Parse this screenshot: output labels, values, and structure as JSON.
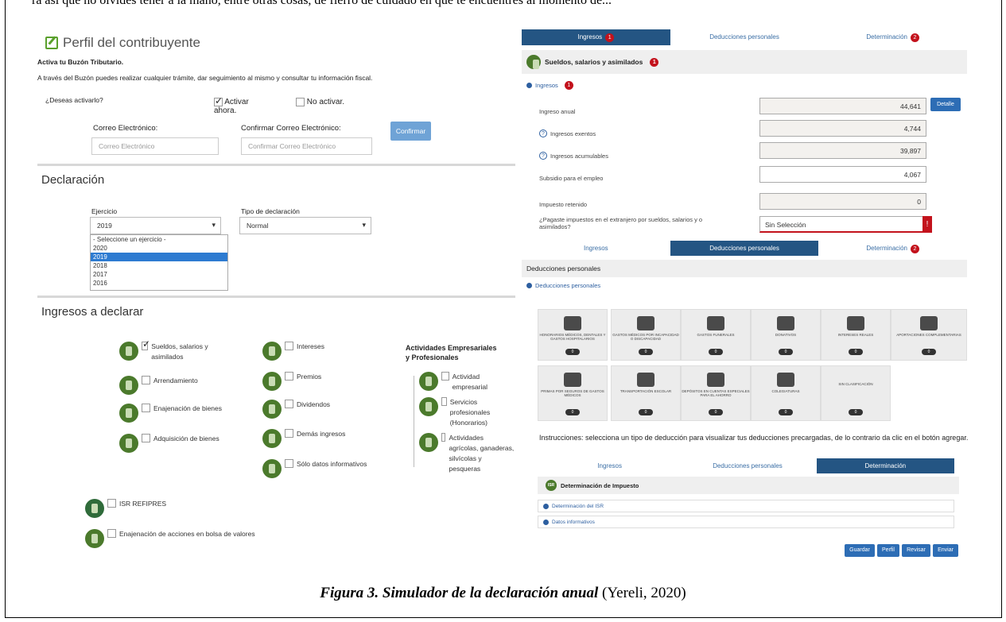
{
  "top_text": "ra así que no olvides tener a la mano, entre otras cosas, de fierro de cuidado en que te encuentres al momento de...",
  "perfil": {
    "title": "Perfil del contribuyente",
    "subtitle": "Activa tu Buzón Tributario.",
    "desc": "A través del Buzón puedes realizar cualquier trámite, dar seguimiento al mismo y consultar tu información fiscal.",
    "question": "¿Deseas activarlo?",
    "opt_yes": "Activar ahora.",
    "opt_no": "No activar.",
    "email_label": "Correo Electrónico:",
    "email_placeholder": "Correo Electrónico",
    "confirm_label": "Confirmar Correo Electrónico:",
    "confirm_placeholder": "Confirmar Correo Electrónico",
    "confirm_button": "Confirmar"
  },
  "declaracion": {
    "title": "Declaración",
    "ejercicio_label": "Ejercicio",
    "ejercicio_value": "2019",
    "tipo_label": "Tipo de declaración",
    "tipo_value": "Normal",
    "options": [
      "- Seleccione un ejercicio -",
      "2020",
      "2019",
      "2018",
      "2017",
      "2016"
    ]
  },
  "ingresos": {
    "title": "Ingresos a declarar",
    "col1": [
      "Sueldos, salarios y asimilados",
      "Arrendamiento",
      "Enajenación de bienes",
      "Adquisición de bienes"
    ],
    "col2": [
      "Intereses",
      "Premios",
      "Dividendos",
      "Demás ingresos",
      "Sólo datos informativos"
    ],
    "col3_title": "Actividades Empresariales y Profesionales",
    "col3": [
      "Actividad empresarial",
      "Servicios profesionales (Honorarios)",
      "Actividades agrícolas, ganaderas, silvícolas y pesqueras"
    ],
    "isr_refipres": "ISR REFIPRES",
    "isr_badge": "ISR",
    "enajenacion_acciones": "Enajenación de acciones en bolsa de valores"
  },
  "tabs1": {
    "ingresos": "Ingresos",
    "ingresos_badge": "1",
    "deducciones": "Deducciones personales",
    "determinacion": "Determinación",
    "determinacion_badge": "2"
  },
  "sueldos": {
    "header": "Sueldos, salarios y asimilados",
    "header_badge": "1",
    "sub": "Ingresos",
    "sub_badge": "1",
    "rows": [
      {
        "label": "Ingreso anual",
        "value": "44,641"
      },
      {
        "label": "Ingresos exentos",
        "value": "4,744"
      },
      {
        "label": "Ingresos acumulables",
        "value": "39,897"
      },
      {
        "label": "Subsidio para el empleo",
        "value": "4,067"
      },
      {
        "label": "Impuesto retenido",
        "value": "0"
      }
    ],
    "detalle": "Detalle",
    "extranjero_label": "¿Pagaste impuestos en el extranjero por sueldos, salarios y o asimilados?",
    "extranjero_value": "Sin Selección"
  },
  "deducciones": {
    "header": "Deducciones personales",
    "sub": "Deducciones personales",
    "row1": [
      "HONORARIOS MÉDICOS, DENTALES Y GASTOS HOSPITALARIOS",
      "GASTOS MÉDICOS POR INCAPACIDAD O DISCAPACIDAD",
      "GASTOS FUNERALES",
      "DONATIVOS",
      "INTERESES REALES",
      "APORTACIONES COMPLEMENTARIAS"
    ],
    "row2": [
      "PRIMAS POR SEGUROS DE GASTOS MÉDICOS",
      "TRANSPORTACIÓN ESCOLAR",
      "DEPÓSITOS EN CUENTAS ESPECIALES PARA EL AHORRO",
      "COLEGIATURAS",
      "SIN CLASIFICACIÓN"
    ],
    "count": "0",
    "instructions": "Instrucciones: selecciona un tipo de deducción para visualizar tus deducciones precargadas, de lo contrario da clic en el botón agregar."
  },
  "determinacion": {
    "header": "Determinación de Impuesto",
    "isr_badge": "ISR",
    "items": [
      "Determinación del ISR",
      "Datos informativos"
    ],
    "buttons": [
      "Guardar",
      "Perfil",
      "Revisar",
      "Enviar"
    ]
  },
  "caption": {
    "bold": "Figura 3. Simulador de la declaración anual",
    "normal": " (Yereli, 2020)"
  }
}
